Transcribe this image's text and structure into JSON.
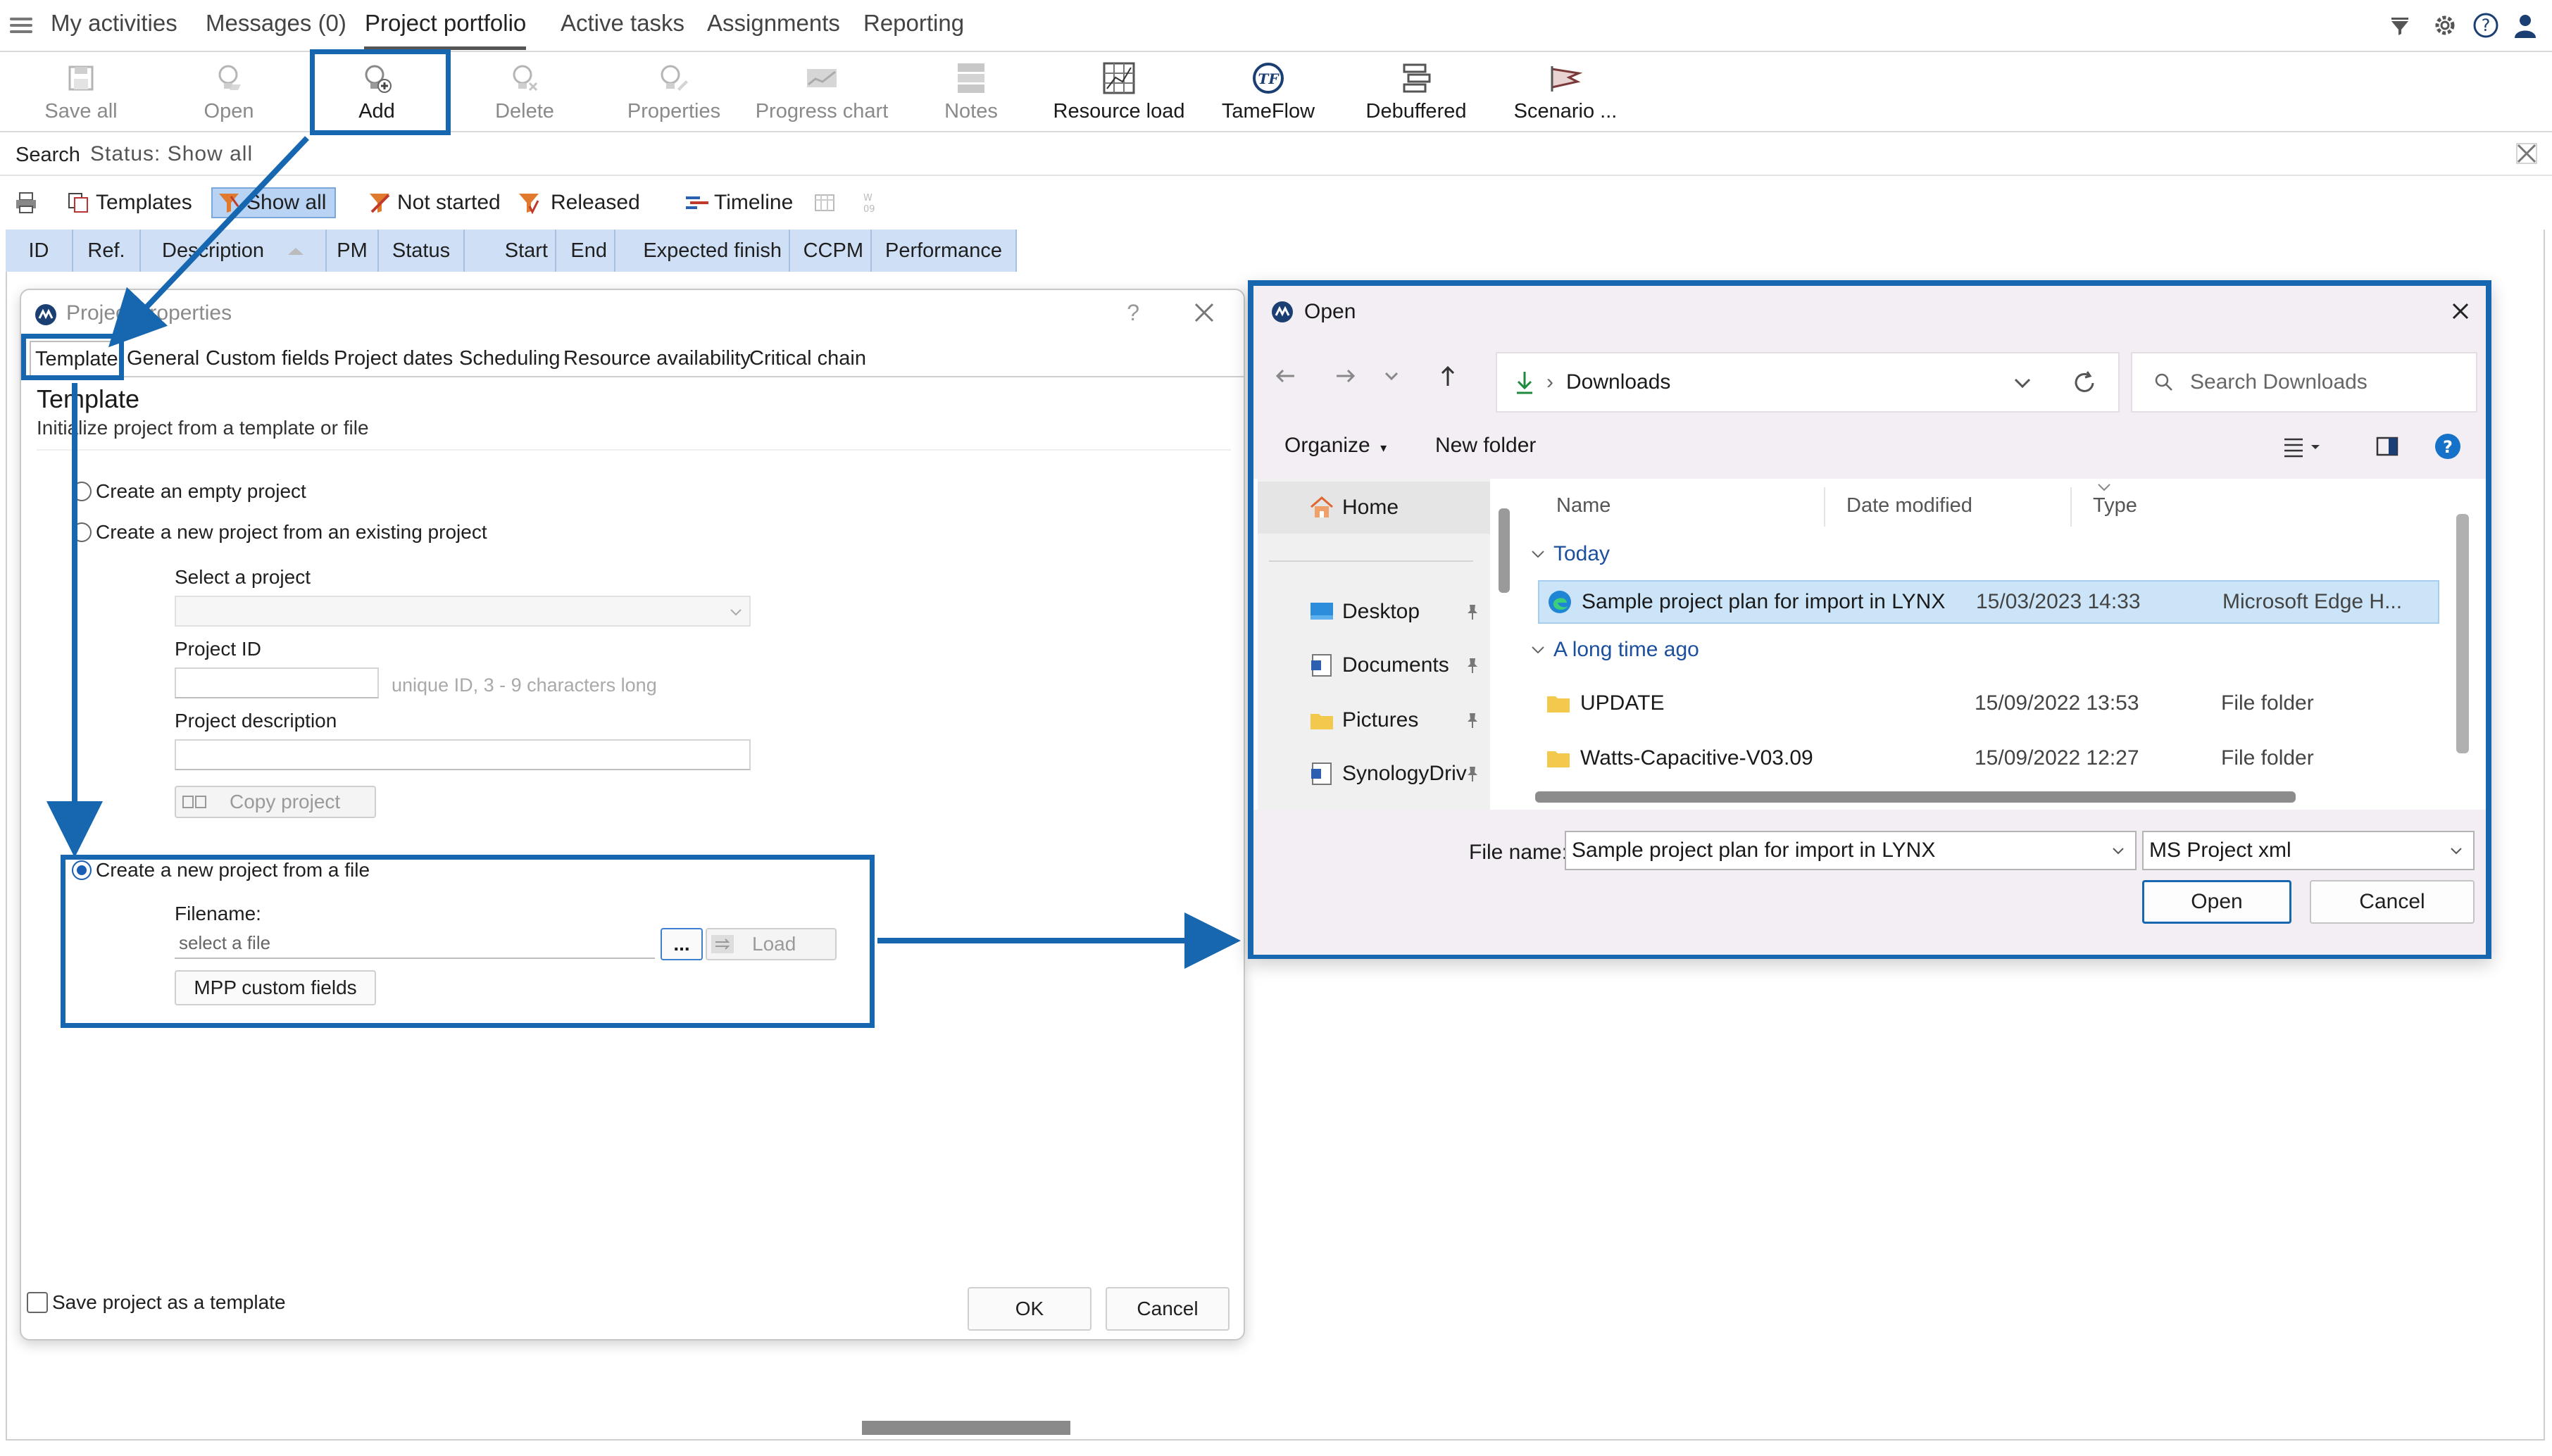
{
  "menu": {
    "items": [
      {
        "label": "My activities"
      },
      {
        "label": "Messages (0)"
      },
      {
        "label": "Project portfolio"
      },
      {
        "label": "Active tasks"
      },
      {
        "label": "Assignments"
      },
      {
        "label": "Reporting"
      }
    ],
    "active": "Project portfolio",
    "right_icons": [
      "filter-funnel-icon",
      "gear-icon",
      "help-icon",
      "user-icon"
    ]
  },
  "ribbon": {
    "buttons": [
      {
        "label": "Save all",
        "icon": "save-icon",
        "enabled": false
      },
      {
        "label": "Open",
        "icon": "open-project-icon",
        "enabled": false
      },
      {
        "label": "Add",
        "icon": "add-project-icon",
        "enabled": true
      },
      {
        "label": "Delete",
        "icon": "delete-project-icon",
        "enabled": false
      },
      {
        "label": "Properties",
        "icon": "properties-icon",
        "enabled": false
      },
      {
        "label": "Progress chart",
        "icon": "progress-chart-icon",
        "enabled": false
      },
      {
        "label": "Notes",
        "icon": "notes-icon",
        "enabled": false
      },
      {
        "label": "Resource load",
        "icon": "resource-load-icon",
        "enabled": true
      },
      {
        "label": "TameFlow",
        "icon": "tameflow-icon",
        "enabled": true
      },
      {
        "label": "Debuffered",
        "icon": "debuffered-icon",
        "enabled": true
      },
      {
        "label": "Scenario ...",
        "icon": "scenario-icon",
        "enabled": true
      }
    ]
  },
  "search": {
    "label": "Search",
    "status_filter": "Status: Show all"
  },
  "filters": {
    "templates": "Templates",
    "show_all": "Show all",
    "not_started": "Not started",
    "released": "Released",
    "timeline": "Timeline"
  },
  "grid": {
    "columns": [
      "ID",
      "Ref.",
      "Description",
      "PM",
      "Status",
      "Start",
      "End",
      "Expected finish",
      "CCPM",
      "Performance"
    ]
  },
  "project_properties": {
    "title": "Project properties",
    "help": "?",
    "tabs": [
      "Template",
      "General",
      "Custom fields",
      "Project dates",
      "Scheduling",
      "Resource availability",
      "Critical chain"
    ],
    "section_title": "Template",
    "section_subtitle": "Initialize project from a template or file",
    "options": {
      "empty": "Create an empty project",
      "existing": "Create a new project from an existing project",
      "file": "Create a new project from a file"
    },
    "selected_option": "file",
    "select_project_label": "Select a project",
    "select_project_value": "",
    "project_id_label": "Project ID",
    "project_id_value": "",
    "project_id_hint": "unique ID, 3 - 9 characters long",
    "project_description_label": "Project description",
    "project_description_value": "",
    "copy_project_label": "Copy project",
    "filename_label": "Filename:",
    "filename_placeholder": "select a file",
    "browse_label": "...",
    "load_label": "Load",
    "mpp_custom_fields_label": "MPP custom fields",
    "save_as_template_label": "Save project as a template",
    "save_as_template_checked": false,
    "ok_label": "OK",
    "cancel_label": "Cancel"
  },
  "open_dialog": {
    "title": "Open",
    "address": "Downloads",
    "search_placeholder": "Search Downloads",
    "organize_label": "Organize",
    "new_folder_label": "New folder",
    "sidebar": [
      {
        "label": "Home",
        "icon": "home-icon",
        "pinned": false
      },
      {
        "label": "Desktop",
        "icon": "desktop-icon",
        "pinned": true
      },
      {
        "label": "Documents",
        "icon": "documents-icon",
        "pinned": true
      },
      {
        "label": "Pictures",
        "icon": "pictures-icon",
        "pinned": true
      },
      {
        "label": "SynologyDriv",
        "icon": "synology-drive-icon",
        "pinned": true
      }
    ],
    "columns": {
      "name": "Name",
      "date": "Date modified",
      "type": "Type"
    },
    "groups": [
      {
        "label": "Today",
        "files": [
          {
            "name": "Sample project plan for import in LYNX",
            "date": "15/03/2023 14:33",
            "type": "Microsoft Edge H...",
            "icon": "edge-icon",
            "selected": true
          }
        ]
      },
      {
        "label": "A long time ago",
        "files": [
          {
            "name": "UPDATE",
            "date": "15/09/2022 13:53",
            "type": "File folder",
            "icon": "folder-icon",
            "selected": false
          },
          {
            "name": "Watts-Capacitive-V03.09",
            "date": "15/09/2022 12:27",
            "type": "File folder",
            "icon": "folder-icon",
            "selected": false
          }
        ]
      }
    ],
    "file_name_label": "File name:",
    "file_name_value": "Sample project plan for import in LYNX",
    "file_type_value": "MS Project xml",
    "open_label": "Open",
    "cancel_label": "Cancel"
  },
  "colors": {
    "highlight": "#1666b0",
    "grid_header": "#cfe0f6",
    "selected_row": "#cce4f7",
    "dialog_chrome": "#f3edf4"
  }
}
